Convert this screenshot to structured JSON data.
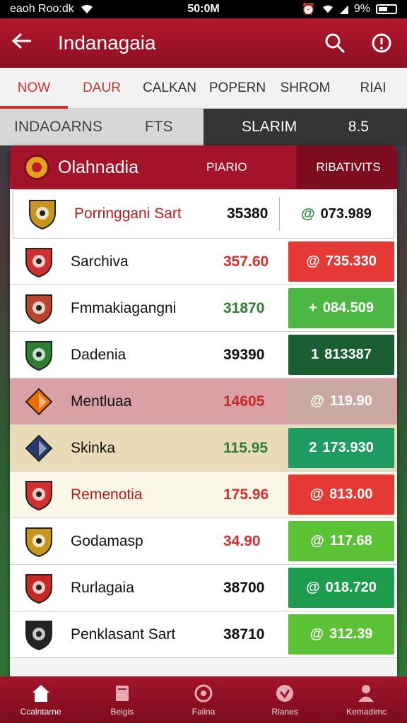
{
  "status": {
    "carrier": "eaoh Roo:dk",
    "time": "50:0M",
    "battery": "9%"
  },
  "appbar": {
    "title": "Indanagaia"
  },
  "tabs": [
    {
      "label": "NOW",
      "active": true
    },
    {
      "label": "DAUR",
      "active": false
    },
    {
      "label": "CALKAN",
      "active": false
    },
    {
      "label": "POPERN",
      "active": false
    },
    {
      "label": "SHROM",
      "active": false
    },
    {
      "label": "RIAI",
      "active": false
    }
  ],
  "subbar": {
    "left1": "INDAOARNS",
    "left2": "FTS",
    "right1": "SLARIM",
    "right2": "8.5"
  },
  "panel": {
    "name": "Olahnadia",
    "col1": "PIARIO",
    "col2": "RIBATIVITS"
  },
  "rows": [
    {
      "team": "Porringgani Sart",
      "value": "35380",
      "value_color": "#111111",
      "change_symbol": "@",
      "change": "073.989",
      "change_bg": "#ffffff",
      "logo_color": "#c8961c",
      "logo_icon": "shield-icon"
    },
    {
      "team": "Sarchiva",
      "value": "357.60",
      "value_color": "#d32f2f",
      "change_symbol": "@",
      "change": "735.330",
      "change_bg": "#e53935",
      "logo_color": "#d32f2f",
      "logo_icon": "shield-icon"
    },
    {
      "team": "Fmmakiagangni",
      "value": "31870",
      "value_color": "#2e7d32",
      "change_symbol": "+",
      "change": "084.509",
      "change_bg": "#4cb843",
      "logo_color": "#b8452c",
      "logo_icon": "shield-icon"
    },
    {
      "team": "Dadenia",
      "value": "39390",
      "value_color": "#111111",
      "change_symbol": "1",
      "change": "813387",
      "change_bg": "#1b5e32",
      "logo_color": "#2e7d32",
      "logo_icon": "shield-icon"
    },
    {
      "team": "Mentluaa",
      "value": "14605",
      "value_color": "#c62828",
      "change_symbol": "@",
      "change": "119.90",
      "change_bg": "#c8a8a0",
      "logo_color": "#ef6c00",
      "logo_icon": "diamond-icon"
    },
    {
      "team": "Skinka",
      "value": "115.95",
      "value_color": "#2e7d32",
      "change_symbol": "2",
      "change": "173.930",
      "change_bg": "#1f9a63",
      "logo_color": "#263a6e",
      "logo_icon": "diamond-icon"
    },
    {
      "team": "Remenotia",
      "value": "175.96",
      "value_color": "#d32f2f",
      "change_symbol": "@",
      "change": "813.00",
      "change_bg": "#e53935",
      "logo_color": "#d32f2f",
      "logo_icon": "shield-icon"
    },
    {
      "team": "Godamasp",
      "value": "34.90",
      "value_color": "#d32f2f",
      "change_symbol": "@",
      "change": "117.68",
      "change_bg": "#5bc236",
      "logo_color": "#c8961c",
      "logo_icon": "shield-icon"
    },
    {
      "team": "Rurlagaia",
      "value": "38700",
      "value_color": "#111111",
      "change_symbol": "@",
      "change": "018.720",
      "change_bg": "#1e9c4e",
      "logo_color": "#c62828",
      "logo_icon": "shield-icon"
    },
    {
      "team": "Penklasant Sart",
      "value": "38710",
      "value_color": "#111111",
      "change_symbol": "@",
      "change": "312.39",
      "change_bg": "#5bc236",
      "logo_color": "#222222",
      "logo_icon": "shield-icon"
    }
  ],
  "row_backgrounds": [
    "#ffffff",
    "#ffffff",
    "#ffffff",
    "#ffffff",
    "#d9a0a6",
    "#eadbb8",
    "#fbf7e6",
    "#ffffff",
    "#ffffff",
    "#ffffff"
  ],
  "bottom_nav": [
    {
      "label": "Ccalntarne",
      "icon": "home-icon",
      "active": true
    },
    {
      "label": "Beigis",
      "icon": "folder-icon",
      "active": false
    },
    {
      "label": "Faiina",
      "icon": "ball-icon",
      "active": false
    },
    {
      "label": "Rlanes",
      "icon": "check-circle-icon",
      "active": false
    },
    {
      "label": "Kemadimc",
      "icon": "person-icon",
      "active": false
    }
  ]
}
